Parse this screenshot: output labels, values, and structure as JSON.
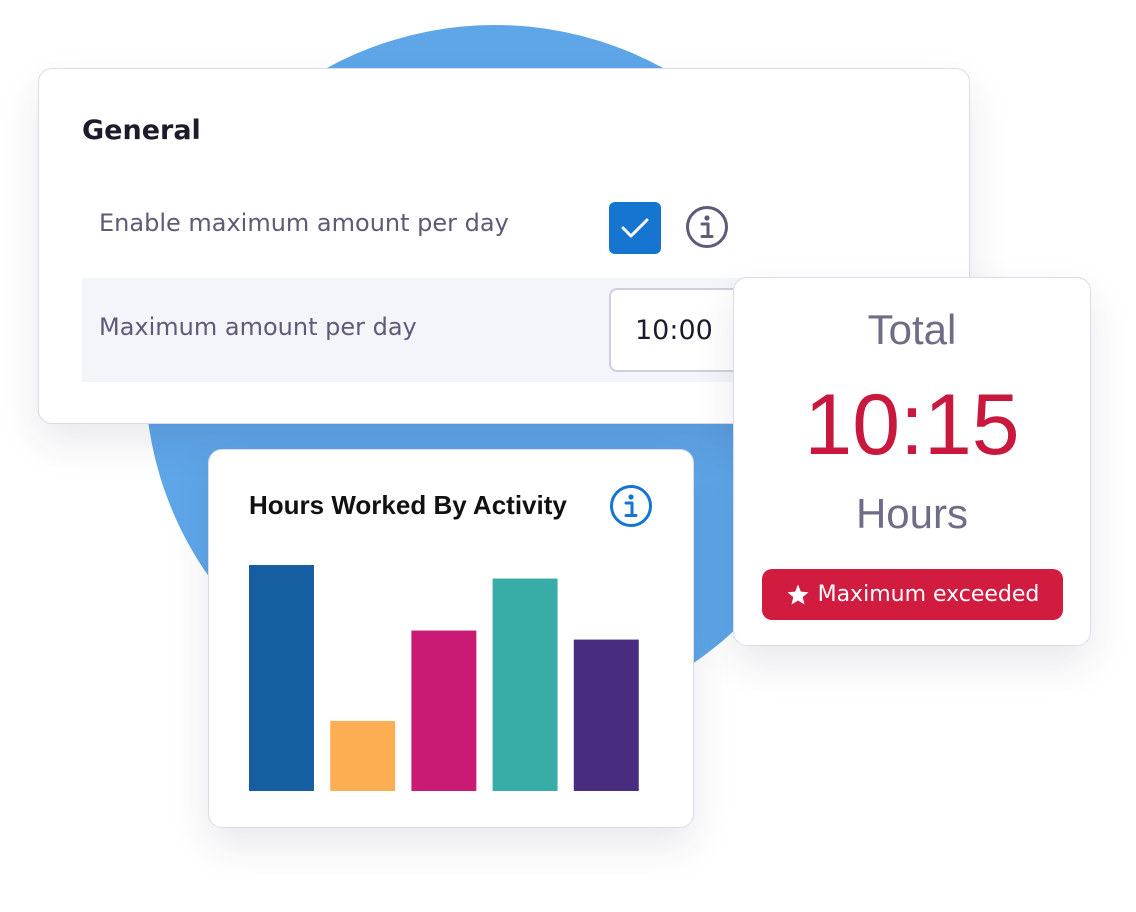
{
  "general": {
    "title": "General",
    "enable_max_label": "Enable maximum amount per day",
    "enable_max_checked": true,
    "max_amount_label": "Maximum amount per day",
    "max_amount_value": "10:00"
  },
  "total": {
    "label": "Total",
    "value": "10:15",
    "unit": "Hours",
    "badge_icon": "star-icon",
    "badge_text": "Maximum exceeded"
  },
  "colors": {
    "accent_blue": "#1675d1",
    "background_circle": "#5ea6e8",
    "alert_red": "#d11c3f",
    "total_value_red": "#c8183e"
  },
  "chart_data": {
    "type": "bar",
    "title": "Hours Worked By Activity",
    "categories": [
      "",
      "",
      "",
      "",
      ""
    ],
    "values": [
      100,
      31,
      71,
      94,
      67
    ],
    "colors": [
      "#155ea1",
      "#feae52",
      "#c91b73",
      "#38aca6",
      "#472c80"
    ],
    "ylim": [
      0,
      100
    ],
    "grid": false
  }
}
